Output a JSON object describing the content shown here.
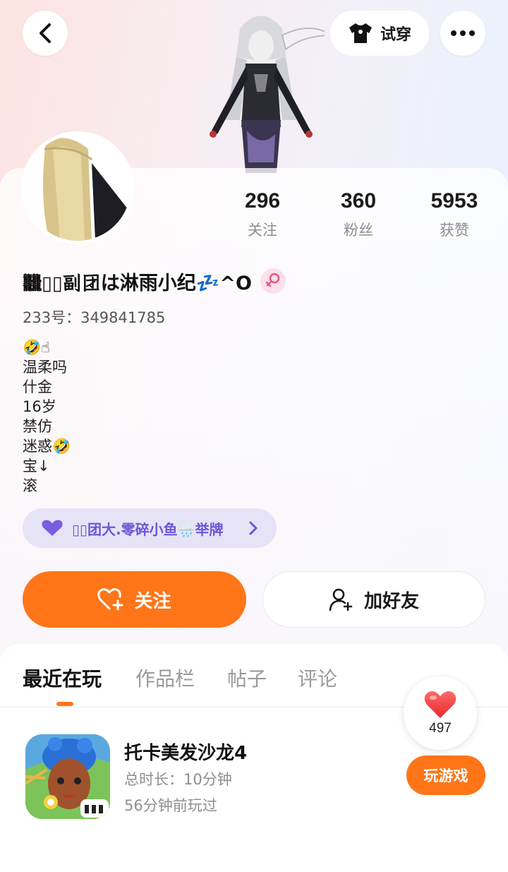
{
  "header": {
    "try_on_label": "试穿",
    "icons": [
      "back-arrow-icon",
      "tshirt-icon",
      "more-icon"
    ]
  },
  "stats": [
    {
      "value": "296",
      "label": "关注"
    },
    {
      "value": "360",
      "label": "粉丝"
    },
    {
      "value": "5953",
      "label": "获赞"
    }
  ],
  "profile": {
    "nickname": "𪚥▯▯副团は淋雨小纪💤^O",
    "gender": "female",
    "uid_text": "233号：349841785",
    "bio": "🤣☝\n温柔吗\n什金\n16岁\n禁仿\n迷惑🤣\n宝↓\n滚",
    "club_text": "▯▯团大.零碎小鱼🌧️举牌"
  },
  "actions": {
    "follow_label": "关注",
    "add_friend_label": "加好友"
  },
  "tabs": {
    "items": [
      "最近在玩",
      "作品栏",
      "帖子",
      "评论"
    ],
    "active": 0
  },
  "recent_game": {
    "title": "托卡美发沙龙4",
    "duration": "总时长：10分钟",
    "last_played": "56分钟前玩过",
    "play_label": "玩游戏"
  },
  "likes": {
    "count": "497"
  },
  "colors": {
    "accent": "#ff7517",
    "club_text": "#6a57d8",
    "club_bg": "#e7e3f7",
    "gender_pink": "#e8548a"
  }
}
